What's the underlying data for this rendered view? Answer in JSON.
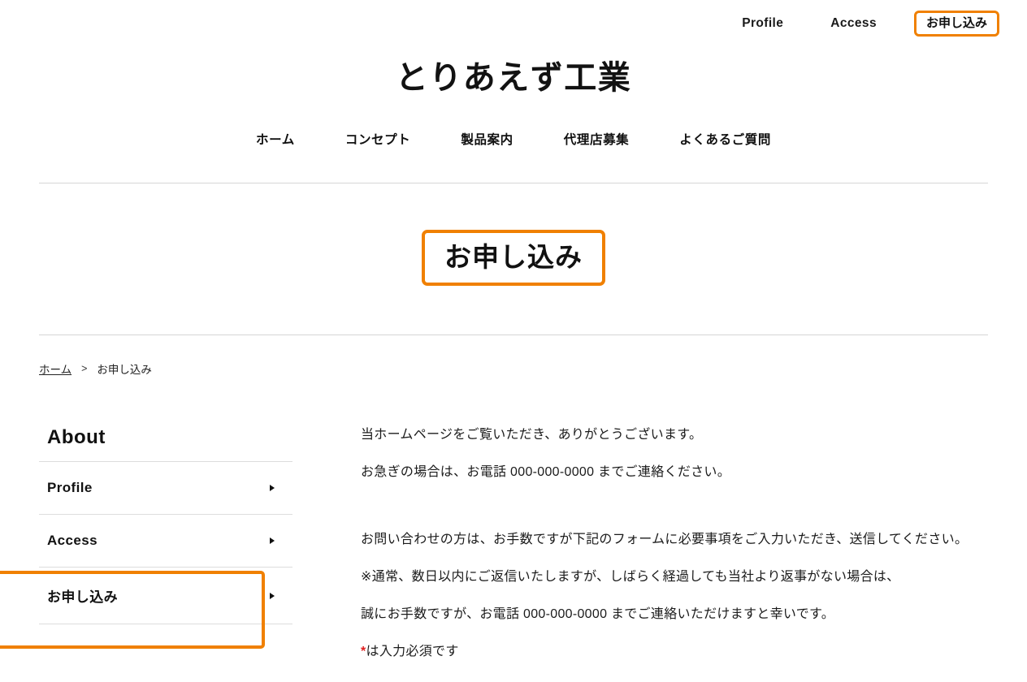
{
  "header": {
    "utility_nav": [
      {
        "label": "Profile"
      },
      {
        "label": "Access"
      }
    ],
    "cta_label": "お申し込み",
    "site_title": "とりあえず工業",
    "global_nav": [
      {
        "label": "ホーム"
      },
      {
        "label": "コンセプト"
      },
      {
        "label": "製品案内"
      },
      {
        "label": "代理店募集"
      },
      {
        "label": "よくあるご質問"
      }
    ]
  },
  "page_title": "お申し込み",
  "breadcrumb": {
    "home_label": "ホーム",
    "separator": ">",
    "current_label": "お申し込み"
  },
  "sidebar": {
    "heading": "About",
    "items": [
      {
        "label": "Profile",
        "arrow": "triangle-right-icon",
        "active": false
      },
      {
        "label": "Access",
        "arrow": "triangle-right-icon",
        "active": false
      },
      {
        "label": "お申し込み",
        "arrow": "triangle-right-icon",
        "active": true
      }
    ]
  },
  "main": {
    "paragraphs": [
      "当ホームページをご覧いただき、ありがとうございます。",
      "お急ぎの場合は、お電話 000-000-0000 までご連絡ください。",
      "お問い合わせの方は、お手数ですが下記のフォームに必要事項をご入力いただき、送信してください。",
      "※通常、数日以内にご返信いたしますが、しばらく経過しても当社より返事がない場合は、",
      "誠にお手数ですが、お電話 000-000-0000 までご連絡いただけますと幸いです。"
    ],
    "required_note_mark": "*",
    "required_note_text": "は入力必須です"
  },
  "colors": {
    "accent_orange": "#F08000",
    "required_red": "#e02020",
    "divider_gray": "#d6d6d6",
    "text": "#1a1a1a"
  }
}
